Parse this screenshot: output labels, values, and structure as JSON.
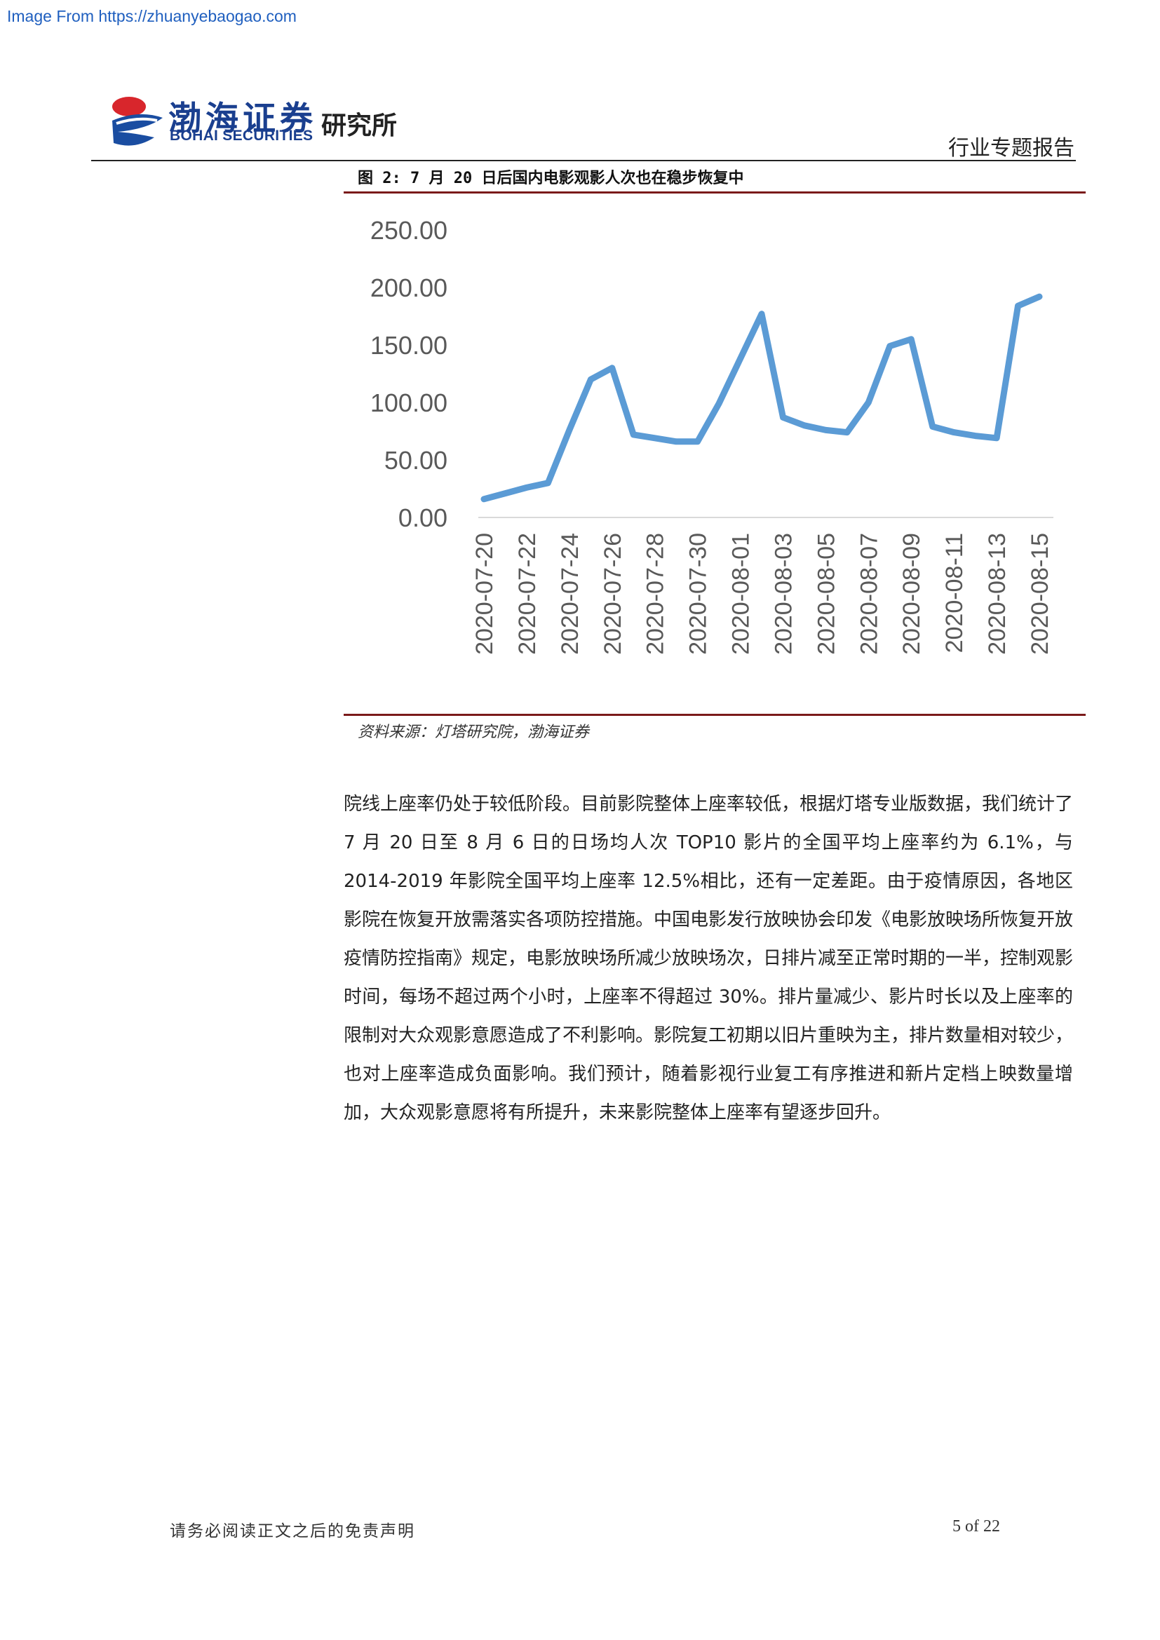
{
  "watermark": "Image From https://zhuanyebaogao.com",
  "header": {
    "logo_cn": "渤海证券",
    "logo_en": "BOHAI SECURITIES",
    "logo_sub": "研究所",
    "report_type": "行业专题报告"
  },
  "figure": {
    "title": "图 2: 7 月 20 日后国内电影观影人次也在稳步恢复中",
    "source": "资料来源：灯塔研究院，渤海证券"
  },
  "chart_data": {
    "type": "line",
    "title": "",
    "xlabel": "",
    "ylabel": "",
    "ylim": [
      0,
      250
    ],
    "yticks": [
      "250.00",
      "200.00",
      "150.00",
      "100.00",
      "50.00",
      "0.00"
    ],
    "x": [
      "2020-07-20",
      "2020-07-21",
      "2020-07-22",
      "2020-07-23",
      "2020-07-24",
      "2020-07-25",
      "2020-07-26",
      "2020-07-27",
      "2020-07-28",
      "2020-07-29",
      "2020-07-30",
      "2020-07-31",
      "2020-08-01",
      "2020-08-02",
      "2020-08-03",
      "2020-08-04",
      "2020-08-05",
      "2020-08-06",
      "2020-08-07",
      "2020-08-08",
      "2020-08-09",
      "2020-08-10",
      "2020-08-11",
      "2020-08-12",
      "2020-08-13",
      "2020-08-14",
      "2020-08-15"
    ],
    "xticks": [
      "2020-07-20",
      "2020-07-22",
      "2020-07-24",
      "2020-07-26",
      "2020-07-28",
      "2020-07-30",
      "2020-08-01",
      "2020-08-03",
      "2020-08-05",
      "2020-08-07",
      "2020-08-09",
      "2020-08-11",
      "2020-08-13",
      "2020-08-15"
    ],
    "series": [
      {
        "values": [
          16,
          21,
          26,
          30,
          76,
          120,
          130,
          72,
          69,
          66,
          66,
          99,
          138,
          177,
          87,
          80,
          76,
          74,
          100,
          149,
          155,
          79,
          74,
          71,
          69,
          184,
          192
        ]
      }
    ],
    "line_color": "#5b9bd5",
    "grid": false,
    "legend": "none"
  },
  "body": {
    "paragraph": "院线上座率仍处于较低阶段。目前影院整体上座率较低，根据灯塔专业版数据，我们统计了 7 月 20 日至 8 月 6 日的日场均人次 TOP10 影片的全国平均上座率约为 6.1%，与 2014-2019 年影院全国平均上座率 12.5%相比，还有一定差距。由于疫情原因，各地区影院在恢复开放需落实各项防控措施。中国电影发行放映协会印发《电影放映场所恢复开放疫情防控指南》规定，电影放映场所减少放映场次，日排片减至正常时期的一半，控制观影时间，每场不超过两个小时，上座率不得超过 30%。排片量减少、影片时长以及上座率的限制对大众观影意愿造成了不利影响。影院复工初期以旧片重映为主，排片数量相对较少，也对上座率造成负面影响。我们预计，随着影视行业复工有序推进和新片定档上映数量增加，大众观影意愿将有所提升，未来影院整体上座率有望逐步回升。"
  },
  "footer": {
    "disclaimer": "请务必阅读正文之后的免责声明",
    "page": "5 of 22"
  }
}
